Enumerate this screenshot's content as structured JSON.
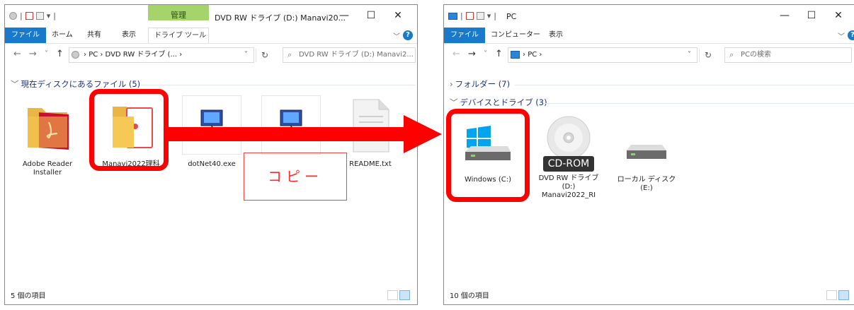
{
  "left_window": {
    "title": "DVD RW ドライブ (D:) Manavi20...",
    "context_tab": "管理",
    "ribbon_tabs": [
      "ファイル",
      "ホーム",
      "共有",
      "表示",
      "ドライブ ツール"
    ],
    "address": "PC › DVD RW ドライブ (... ›",
    "search_placeholder": "DVD RW ドライブ (D:) Manavi2...",
    "group": "現在ディスクにあるファイル (5)",
    "files": [
      {
        "name": "Adobe Reader Installer",
        "icon": "folder-adobe-icon"
      },
      {
        "name": "Manavi2022理科",
        "icon": "folder-document-icon"
      },
      {
        "name": "dotNet40.exe",
        "icon": "installer-icon"
      },
      {
        "name": "",
        "icon": "installer-icon"
      },
      {
        "name": "README.txt",
        "icon": "text-file-icon"
      }
    ],
    "status": "5 個の項目"
  },
  "right_window": {
    "title": "PC",
    "ribbon_tabs": [
      "ファイル",
      "コンピューター",
      "表示"
    ],
    "address": "PC ›",
    "search_placeholder": "PCの検索",
    "groups": [
      "フォルダー (7)",
      "デバイスとドライブ (3)"
    ],
    "drives": [
      {
        "name": "Windows (C:)",
        "icon": "windows-drive-icon"
      },
      {
        "name": "DVD RW ドライブ (D:) Manavi2022_RI",
        "line1": "DVD RW ドライブ",
        "line2": "(D:)",
        "line3": "Manavi2022_RI",
        "badge": "CD-ROM",
        "icon": "cd-rom-icon"
      },
      {
        "name": "ローカル ディスク (E:)",
        "line1": "ローカル ディスク",
        "line2": "(E:)",
        "icon": "hard-drive-icon"
      }
    ],
    "status": "10 個の項目"
  },
  "annotation": {
    "label": "コピー",
    "color": "#ff0000"
  },
  "colors": {
    "accent": "#1979ca",
    "context_tab": "#a5d46a",
    "highlight": "#ff0000",
    "folder": "#f6c955"
  }
}
